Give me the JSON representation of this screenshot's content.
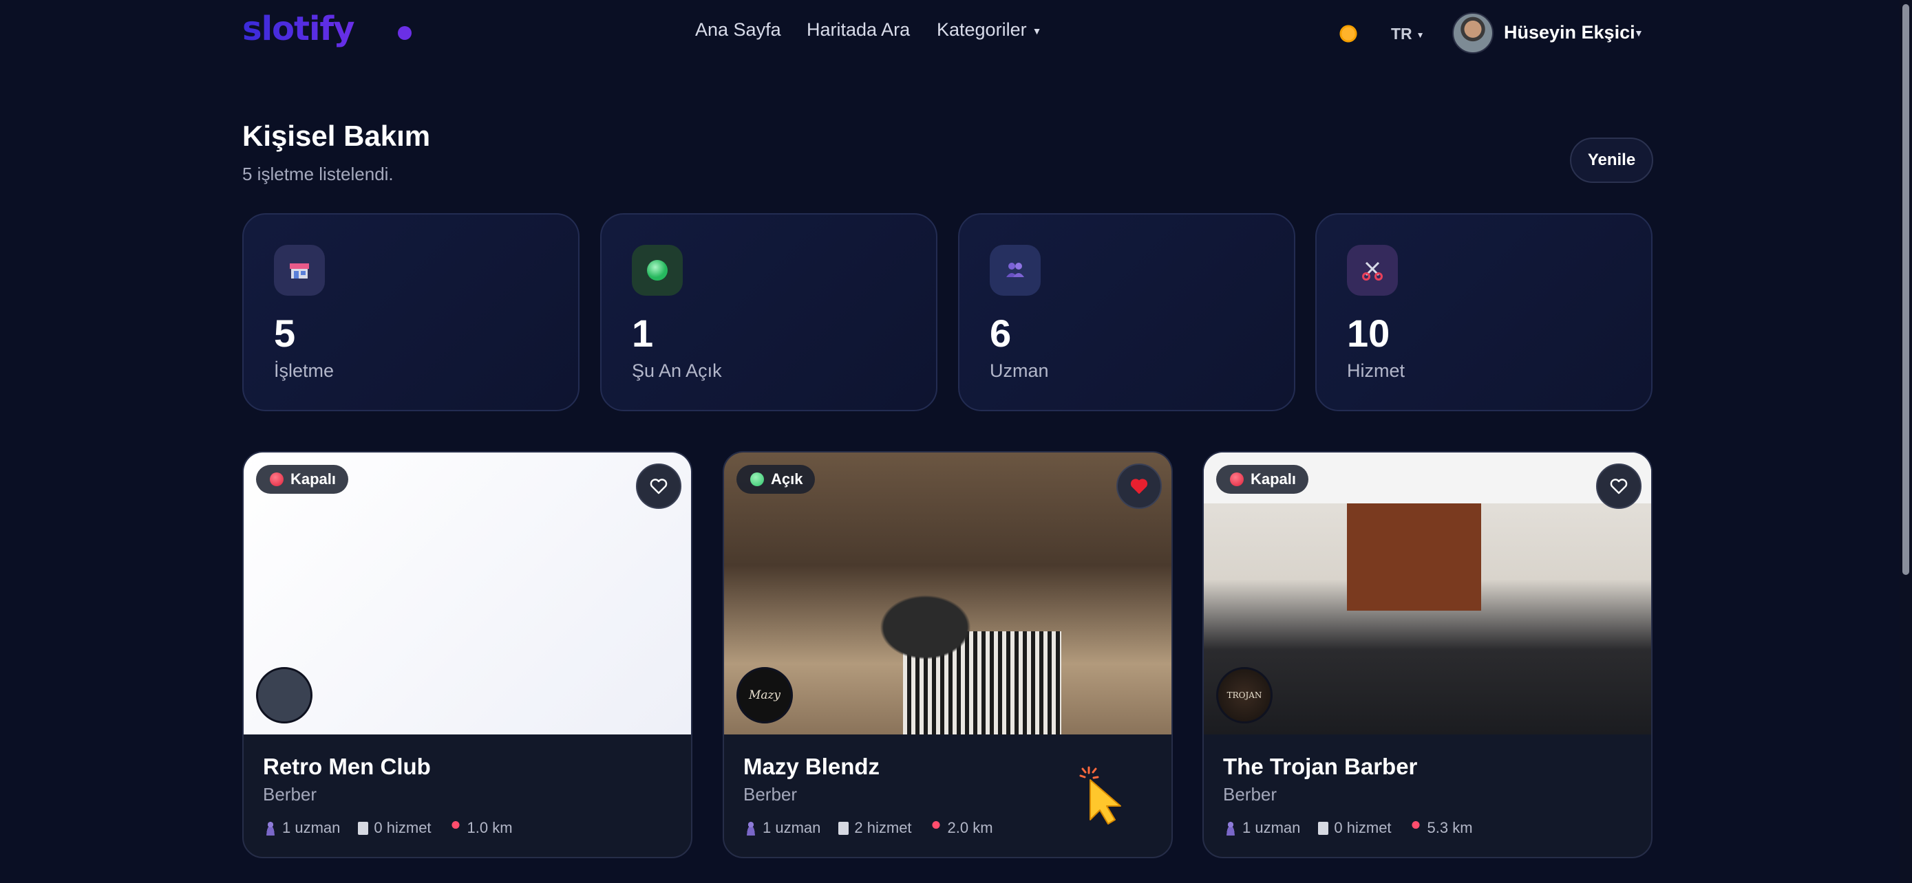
{
  "header": {
    "logo": "slotify",
    "nav": {
      "home": "Ana Sayfa",
      "map": "Haritada Ara",
      "categories": "Kategoriler"
    },
    "theme_icon": "sun-icon",
    "language": "TR",
    "user_name": "Hüseyin Ekşici"
  },
  "page": {
    "title": "Kişisel Bakım",
    "subtitle": "5 işletme listelendi.",
    "refresh_label": "Yenile"
  },
  "stats": [
    {
      "icon": "store-icon",
      "value": "5",
      "label": "İşletme"
    },
    {
      "icon": "green-circle-icon",
      "value": "1",
      "label": "Şu An Açık"
    },
    {
      "icon": "people-icon",
      "value": "6",
      "label": "Uzman"
    },
    {
      "icon": "scissors-icon",
      "value": "10",
      "label": "Hizmet"
    }
  ],
  "cards": [
    {
      "status": "Kapalı",
      "status_color": "#e0223b",
      "favorited": false,
      "name": "Retro Men Club",
      "type": "Berber",
      "experts": "1 uzman",
      "services": "0 hizmet",
      "distance": "1.0 km"
    },
    {
      "status": "Açık",
      "status_color": "#2fc46b",
      "favorited": true,
      "logo_text": "Mazy",
      "name": "Mazy Blendz",
      "type": "Berber",
      "experts": "1 uzman",
      "services": "2 hizmet",
      "distance": "2.0 km"
    },
    {
      "status": "Kapalı",
      "status_color": "#e0223b",
      "favorited": false,
      "logo_text": "TROJAN",
      "name": "The Trojan Barber",
      "type": "Berber",
      "experts": "1 uzman",
      "services": "0 hizmet",
      "distance": "5.3 km"
    }
  ],
  "colors": {
    "background": "#0a0f24",
    "brand": "#4f2fe0",
    "favorite_active": "#e8202f"
  }
}
